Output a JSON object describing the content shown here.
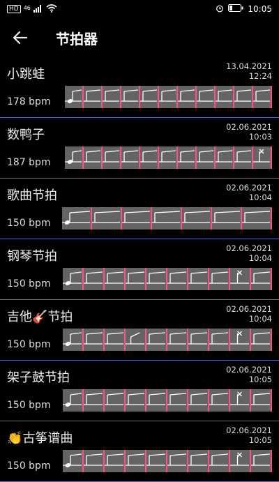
{
  "status": {
    "hd": "HD",
    "network": "46",
    "time": "10:05"
  },
  "header": {
    "title": "节拍器"
  },
  "items": [
    {
      "name": "小跳蛙",
      "date": "13.04.2021",
      "time": "12:24",
      "bpm": "178 bpm",
      "beats": [
        "a",
        "q",
        "q",
        "q",
        "q",
        "q",
        "q",
        "q",
        "q",
        "q",
        "q"
      ]
    },
    {
      "name": "数鸭子",
      "date": "02.06.2021",
      "time": "10:03",
      "bpm": "187 bpm",
      "beats": [
        "a",
        "q",
        "q",
        "q",
        "q",
        "q",
        "q",
        "q",
        "q",
        "q",
        "x"
      ]
    },
    {
      "name": "歌曲节拍",
      "date": "02.06.2021",
      "time": "10:04",
      "bpm": "150 bpm",
      "beats": [
        "a",
        "q",
        "q",
        "q",
        "q",
        "q",
        "q"
      ]
    },
    {
      "name": "钢琴节拍",
      "date": "02.06.2021",
      "time": "10:04",
      "bpm": "150 bpm",
      "beats": [
        "a",
        "q",
        "q",
        "q",
        "q",
        "q",
        "q",
        "q",
        "x",
        "q"
      ]
    },
    {
      "name": "吉他🎸节拍",
      "date": "02.06.2021",
      "time": "10:04",
      "bpm": "150 bpm",
      "beats": [
        "a",
        "q",
        "q",
        "r",
        "q",
        "q",
        "q",
        "q",
        "x",
        "q"
      ]
    },
    {
      "name": "架子鼓节拍",
      "date": "02.06.2021",
      "time": "10:05",
      "bpm": "150 bpm",
      "beats": [
        "a",
        "q",
        "q",
        "q",
        "q",
        "q",
        "q",
        "q",
        "x",
        "q"
      ]
    },
    {
      "name": "👏古筝谱曲",
      "date": "02.06.2021",
      "time": "10:05",
      "bpm": "150 bpm",
      "beats": [
        "a",
        "q",
        "q",
        "q",
        "q",
        "q",
        "q",
        "q",
        "x",
        "q"
      ]
    }
  ]
}
